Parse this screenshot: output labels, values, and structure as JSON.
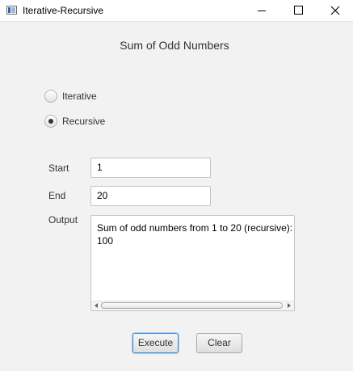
{
  "window": {
    "title": "Iterative-Recursive"
  },
  "heading": "Sum of Odd Numbers",
  "mode": {
    "options": [
      {
        "label": "Iterative",
        "selected": false
      },
      {
        "label": "Recursive",
        "selected": true
      }
    ]
  },
  "form": {
    "start_label": "Start",
    "start_value": "1",
    "end_label": "End",
    "end_value": "20",
    "output_label": "Output",
    "output_lines": [
      "Sum of odd numbers from 1 to 20 (recursive):",
      "100"
    ]
  },
  "buttons": {
    "execute_label": "Execute",
    "clear_label": "Clear"
  }
}
